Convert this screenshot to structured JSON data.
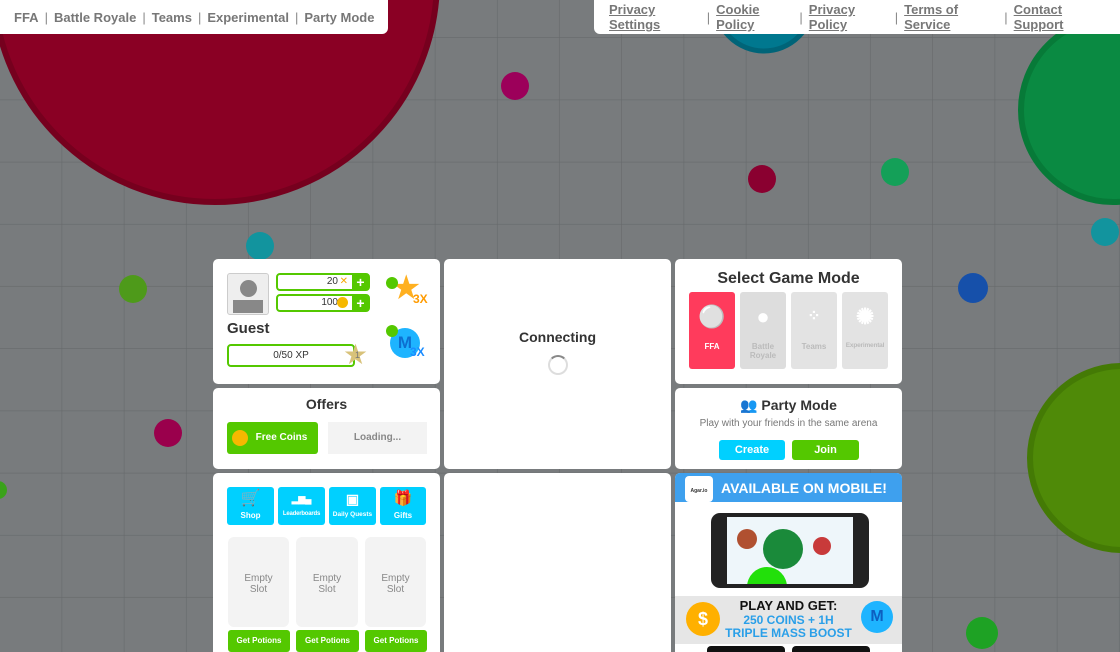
{
  "top_nav": {
    "items": [
      "FFA",
      "Battle Royale",
      "Teams",
      "Experimental",
      "Party Mode"
    ]
  },
  "footer_links": {
    "items": [
      "Privacy Settings",
      "Cookie Policy",
      "Privacy Policy",
      "Terms of Service",
      "Contact Support"
    ]
  },
  "profile": {
    "name": "Guest",
    "dna": "20",
    "coins": "100",
    "xp": "0/50 XP",
    "level": "1",
    "xp_progress": 0,
    "boost_xp": "3X",
    "boost_mass": "3X",
    "plus": "+"
  },
  "offers": {
    "title": "Offers",
    "free_coins": "Free Coins",
    "loading": "Loading..."
  },
  "status": {
    "connecting": "Connecting"
  },
  "menu": {
    "items": [
      "Shop",
      "Leaderboards",
      "Daily Quests",
      "Gifts"
    ],
    "slots": [
      "Empty Slot",
      "Empty Slot",
      "Empty Slot"
    ],
    "potion_button": "Get Potions"
  },
  "game_modes": {
    "title": "Select Game Mode",
    "modes": [
      "FFA",
      "Battle Royale",
      "Teams",
      "Experimental"
    ],
    "selected": "FFA",
    "accent": "#ff3b5c"
  },
  "party": {
    "title": "Party Mode",
    "subtitle": "Play with your friends in the same arena",
    "create": "Create",
    "join": "Join"
  },
  "mobile_ad": {
    "logo": "Agar.io",
    "headline": "AVAILABLE ON MOBILE!",
    "play_get": "PLAY AND GET:",
    "reward1": "250 COINS + 1H",
    "reward2": "TRIPLE MASS BOOST",
    "coin_symbol": "$",
    "mass_symbol": "M"
  }
}
